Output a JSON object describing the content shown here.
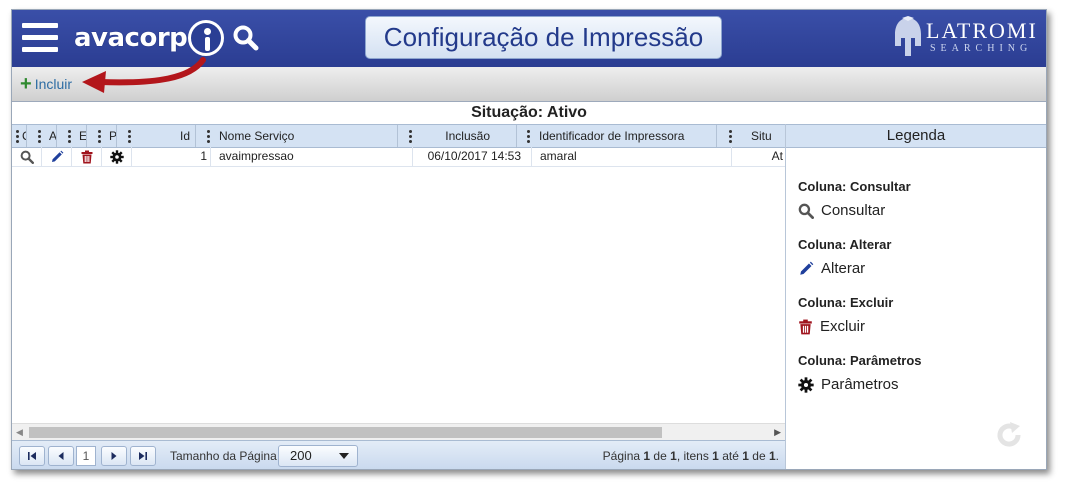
{
  "header": {
    "logo_text": "avacorp",
    "title": "Configuração de Impressão",
    "brand_main": "LATROMI",
    "brand_sub": "SEARCHING"
  },
  "toolbar": {
    "incluir_label": "Incluir"
  },
  "situacao": "Situação: Ativo",
  "grid": {
    "columns": [
      {
        "key": "consultar",
        "label": "C"
      },
      {
        "key": "alterar",
        "label": "A"
      },
      {
        "key": "excluir",
        "label": "E"
      },
      {
        "key": "parametros",
        "label": "P"
      },
      {
        "key": "id",
        "label": "Id"
      },
      {
        "key": "nome",
        "label": "Nome Serviço"
      },
      {
        "key": "inclusao",
        "label": "Inclusão"
      },
      {
        "key": "identificador",
        "label": "Identificador de Impressora"
      },
      {
        "key": "situacao",
        "label": "Situ"
      }
    ],
    "rows": [
      {
        "id": "1",
        "nome": "avaimpressao",
        "inclusao": "06/10/2017 14:53",
        "identificador": "amaral",
        "situacao": "At"
      }
    ]
  },
  "pager": {
    "current_page": "1",
    "page_size_label": "Tamanho da Página",
    "page_size": "200",
    "info_pagina": "Página",
    "info_page": "1",
    "info_de": "de",
    "info_total_pages": "1",
    "info_itens": ", itens",
    "info_from": "1",
    "info_ate": "até",
    "info_to": "1",
    "info_de2": "de",
    "info_total": "1"
  },
  "legend": {
    "title": "Legenda",
    "sections": [
      {
        "title": "Coluna: Consultar",
        "label": "Consultar"
      },
      {
        "title": "Coluna: Alterar",
        "label": "Alterar"
      },
      {
        "title": "Coluna: Excluir",
        "label": "Excluir"
      },
      {
        "title": "Coluna: Parâmetros",
        "label": "Parâmetros"
      }
    ]
  },
  "colors": {
    "header_bg": "#2b3d92",
    "title_text": "#233a8b",
    "edit_icon": "#1f3f9c",
    "delete_icon": "#a0141e",
    "add_icon": "#2f8a2f",
    "arrow": "#b3161b"
  }
}
